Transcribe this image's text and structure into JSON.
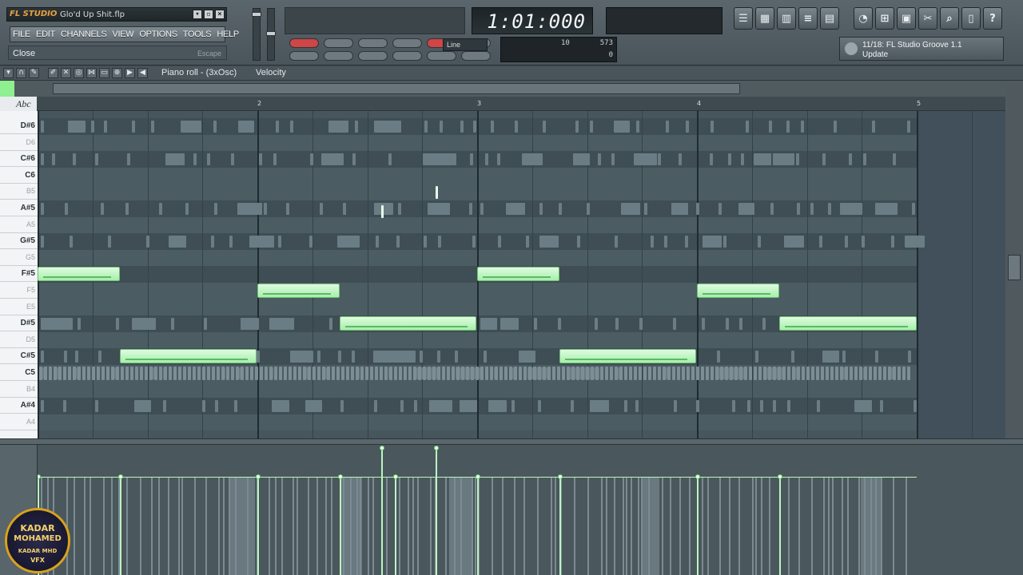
{
  "window": {
    "app_logo": "FL STUDIO",
    "filename": "Glo'd Up Shit.flp"
  },
  "menu": [
    "FILE",
    "EDIT",
    "CHANNELS",
    "VIEW",
    "OPTIONS",
    "TOOLS",
    "HELP"
  ],
  "hint": {
    "text": "Close",
    "shortcut": "Escape"
  },
  "transport": {
    "time_display": "1:01:000",
    "snap_mode": "Line",
    "monitor_value_a": "10",
    "monitor_value_b": "573",
    "monitor_value_c": "0"
  },
  "news": {
    "line1": "11/18: FL Studio Groove 1.1",
    "line2": "Update"
  },
  "piano_roll": {
    "title": "Piano roll - (3xOsc)",
    "lane_label": "Velocity",
    "abc_label": "Abc",
    "bar_numbers": [
      "2",
      "3",
      "4",
      "5"
    ]
  },
  "keys": [
    {
      "name": "D#6",
      "sharp": true
    },
    {
      "name": "D6",
      "sharp": false
    },
    {
      "name": "C#6",
      "sharp": true
    },
    {
      "name": "C6",
      "sharp": false
    },
    {
      "name": "B5",
      "sharp": false
    },
    {
      "name": "A#5",
      "sharp": true
    },
    {
      "name": "A5",
      "sharp": false
    },
    {
      "name": "G#5",
      "sharp": true
    },
    {
      "name": "G5",
      "sharp": false
    },
    {
      "name": "F#5",
      "sharp": true
    },
    {
      "name": "F5",
      "sharp": false
    },
    {
      "name": "E5",
      "sharp": false
    },
    {
      "name": "D#5",
      "sharp": true
    },
    {
      "name": "D5",
      "sharp": false
    },
    {
      "name": "C#5",
      "sharp": true
    },
    {
      "name": "C5",
      "sharp": false
    },
    {
      "name": "B4",
      "sharp": false
    },
    {
      "name": "A#4",
      "sharp": true
    },
    {
      "name": "A4",
      "sharp": false
    }
  ],
  "watermark": {
    "line1": "KADAR",
    "line2": "MOHAMED",
    "line3": "KADAR MHD",
    "line4": "VFX"
  },
  "colors": {
    "note": "#b6f3b9",
    "grid": "#47565d",
    "accent": "#e8a040"
  }
}
